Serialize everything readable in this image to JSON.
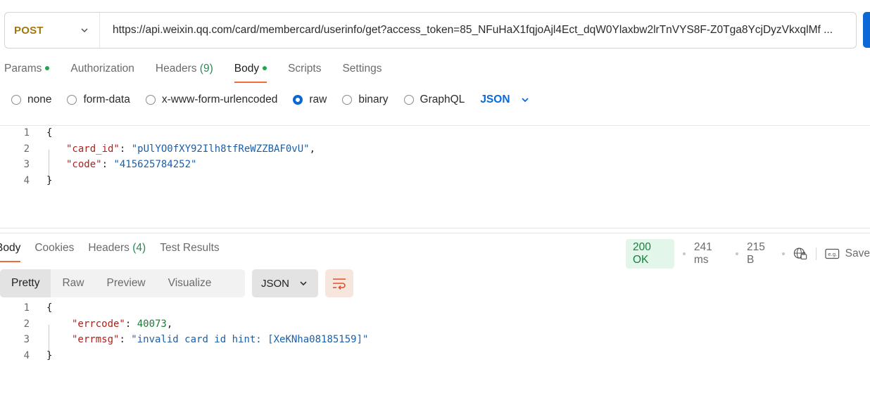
{
  "request": {
    "method": "POST",
    "url": "https://api.weixin.qq.com/card/membercard/userinfo/get?access_token=85_NFuHaX1fqjoAjl4Ect_dqW0Ylaxbw2lrTnVYS8F-Z0Tga8YcjDyzVkxqlMf ..."
  },
  "request_tabs": [
    {
      "label": "Params",
      "dot": true
    },
    {
      "label": "Authorization"
    },
    {
      "label": "Headers",
      "count": "(9)"
    },
    {
      "label": "Body",
      "dot": true,
      "active": true
    },
    {
      "label": "Scripts"
    },
    {
      "label": "Settings"
    }
  ],
  "body_types": [
    "none",
    "form-data",
    "x-www-form-urlencoded",
    "raw",
    "binary",
    "GraphQL"
  ],
  "body_language": "JSON",
  "request_body": {
    "line_numbers": [
      "1",
      "2",
      "3",
      "4"
    ],
    "open_brace": "{",
    "card_id_key": "\"card_id\"",
    "card_id_val": "\"pUlYO0fXY92Ilh8tfReWZZBAF0vU\"",
    "code_key": "\"code\"",
    "code_val": "\"415625784252\"",
    "close_brace": "}"
  },
  "response_tabs": [
    {
      "label": "Body",
      "active": true
    },
    {
      "label": "Cookies"
    },
    {
      "label": "Headers",
      "count": "(4)"
    },
    {
      "label": "Test Results"
    }
  ],
  "response_status": {
    "status": "200 OK",
    "time": "241 ms",
    "size": "215 B",
    "save_label": "Save"
  },
  "response_views": [
    "Pretty",
    "Raw",
    "Preview",
    "Visualize"
  ],
  "response_format": "JSON",
  "response_body": {
    "line_numbers": [
      "1",
      "2",
      "3",
      "4"
    ],
    "open_brace": "{",
    "errcode_key": "\"errcode\"",
    "errcode_val": "40073",
    "errmsg_key": "\"errmsg\"",
    "errmsg_val": "\"invalid card id hint: [XeKNha08185159]\"",
    "close_brace": "}"
  },
  "colors": {
    "accent": "#0c68d6",
    "active_tab_underline": "#ef6c3a",
    "status_ok": "#15803d",
    "method_post": "#a6760e"
  }
}
